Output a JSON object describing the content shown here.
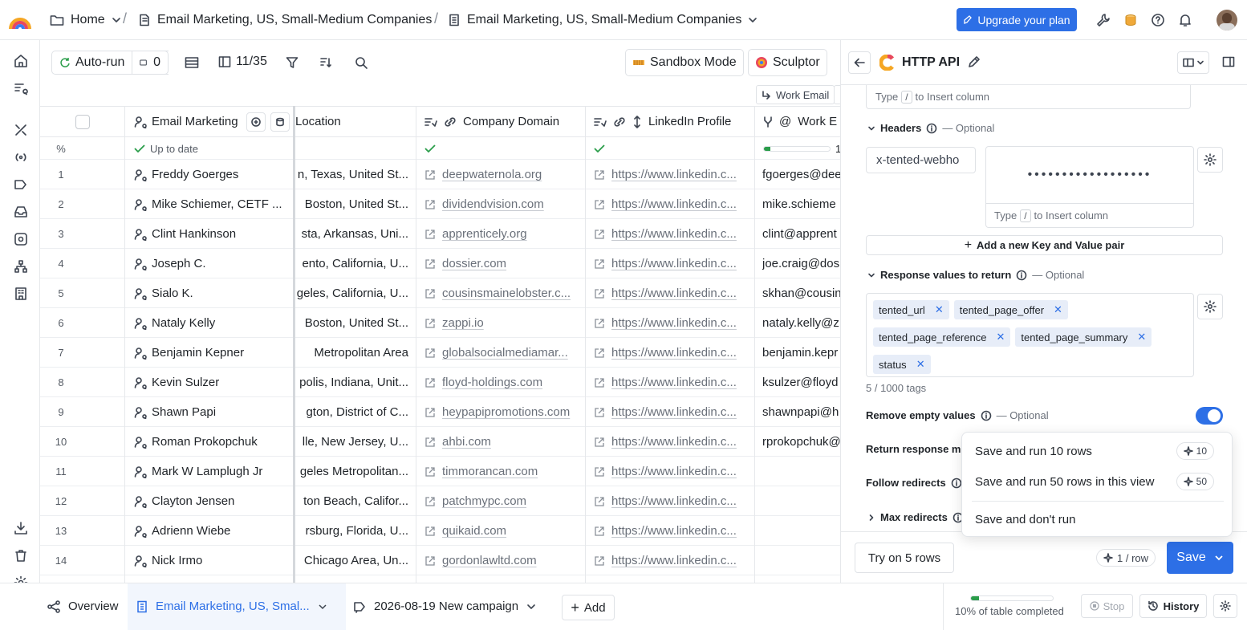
{
  "topbar": {
    "home": "Home",
    "crumb1": "Email Marketing, US, Small-Medium Companies",
    "crumb2": "Email Marketing, US, Small-Medium Companies",
    "upgrade": "Upgrade your plan"
  },
  "toolbar": {
    "autorun": "Auto-run",
    "count": "0",
    "columns": "11/35",
    "sandbox": "Sandbox Mode",
    "sculptor": "Sculptor"
  },
  "grid": {
    "work_email_chip": "Work Email",
    "headers": {
      "name": "Email Marketing",
      "location": "Location",
      "domain": "Company Domain",
      "linkedin": "LinkedIn Profile",
      "work": "Work E"
    },
    "status": {
      "pct": "%",
      "uptodate": "Up to date",
      "work_progress": "1"
    },
    "rows": [
      {
        "n": "1",
        "name": "Freddy Goerges",
        "loc": "n, Texas, United St...",
        "domain": "deepwaternola.org",
        "li": "https://www.linkedin.c...",
        "email": "fgoerges@dee"
      },
      {
        "n": "2",
        "name": "Mike Schiemer, CETF ...",
        "loc": "Boston, United St...",
        "domain": "dividendvision.com",
        "li": "https://www.linkedin.c...",
        "email": "mike.schieme"
      },
      {
        "n": "3",
        "name": "Clint Hankinson",
        "loc": "sta, Arkansas, Uni...",
        "domain": "apprenticely.org",
        "li": "https://www.linkedin.c...",
        "email": "clint@apprent"
      },
      {
        "n": "4",
        "name": "Joseph C.",
        "loc": "ento, California, U...",
        "domain": "dossier.com",
        "li": "https://www.linkedin.c...",
        "email": "joe.craig@dos"
      },
      {
        "n": "5",
        "name": "Sialo K.",
        "loc": "geles, California, U...",
        "domain": "cousinsmainelobster.c...",
        "li": "https://www.linkedin.c...",
        "email": "skhan@cousin"
      },
      {
        "n": "6",
        "name": "Nataly Kelly",
        "loc": "Boston, United St...",
        "domain": "zappi.io",
        "li": "https://www.linkedin.c...",
        "email": "nataly.kelly@z"
      },
      {
        "n": "7",
        "name": "Benjamin Kepner",
        "loc": "Metropolitan Area",
        "domain": "globalsocialmediamar...",
        "li": "https://www.linkedin.c...",
        "email": "benjamin.kepr"
      },
      {
        "n": "8",
        "name": "Kevin Sulzer",
        "loc": "polis, Indiana, Unit...",
        "domain": "floyd-holdings.com",
        "li": "https://www.linkedin.c...",
        "email": "ksulzer@floyd"
      },
      {
        "n": "9",
        "name": "Shawn Papi",
        "loc": "gton, District of C...",
        "domain": "heypapipromotions.com",
        "li": "https://www.linkedin.c...",
        "email": "shawnpapi@h"
      },
      {
        "n": "10",
        "name": "Roman Prokopchuk",
        "loc": "lle, New Jersey, U...",
        "domain": "ahbi.com",
        "li": "https://www.linkedin.c...",
        "email": "rprokopchuk@"
      },
      {
        "n": "11",
        "name": "Mark W Lamplugh Jr",
        "loc": "geles Metropolitan...",
        "domain": "timmorancan.com",
        "li": "https://www.linkedin.c...",
        "email": ""
      },
      {
        "n": "12",
        "name": "Clayton Jensen",
        "loc": "ton Beach, Califor...",
        "domain": "patchmypc.com",
        "li": "https://www.linkedin.c...",
        "email": ""
      },
      {
        "n": "13",
        "name": "Adrienn Wiebe",
        "loc": "rsburg, Florida, U...",
        "domain": "quikaid.com",
        "li": "https://www.linkedin.c...",
        "email": ""
      },
      {
        "n": "14",
        "name": "Nick Irmo",
        "loc": "Chicago Area, Un...",
        "domain": "gordonlawltd.com",
        "li": "https://www.linkedin.c...",
        "email": ""
      }
    ]
  },
  "panel": {
    "title": "HTTP API",
    "type_hint_pre": "Type",
    "type_hint_slash": "/",
    "type_hint_post": "to Insert column",
    "headers_label": "Headers",
    "optional": "— Optional",
    "header_key": "x-tented-webho",
    "header_value_masked": "••••••••••••••••••",
    "add_pair": "Add a new Key and Value pair",
    "response_label": "Response values to return",
    "tags": [
      "tented_url",
      "tented_page_offer",
      "tented_page_reference",
      "tented_page_summary",
      "status"
    ],
    "tag_count": "5 / 1000 tags",
    "remove_empty": "Remove empty values",
    "remove_empty_on": true,
    "return_response": "Return response me",
    "follow_redirects": "Follow redirects",
    "max_redirects": "Max redirects",
    "try_btn": "Try on 5 rows",
    "cost": "1 / row",
    "save": "Save"
  },
  "menu": {
    "items": [
      {
        "label": "Save and run 10 rows",
        "badge": "10"
      },
      {
        "label": "Save and run 50 rows in this view",
        "badge": "50"
      },
      {
        "label": "Save and don't run",
        "badge": ""
      }
    ]
  },
  "bottom": {
    "overview": "Overview",
    "tab1": "Email Marketing, US, Smal...",
    "tab2": "2026-08-19 New campaign",
    "add": "Add",
    "completed": "10% of table completed",
    "completed_fraction": 0.1,
    "stop": "Stop",
    "history": "History"
  },
  "colors": {
    "accent": "#2d6fe6",
    "success": "#2a9d4a",
    "tag_bg": "#e7edf8"
  }
}
